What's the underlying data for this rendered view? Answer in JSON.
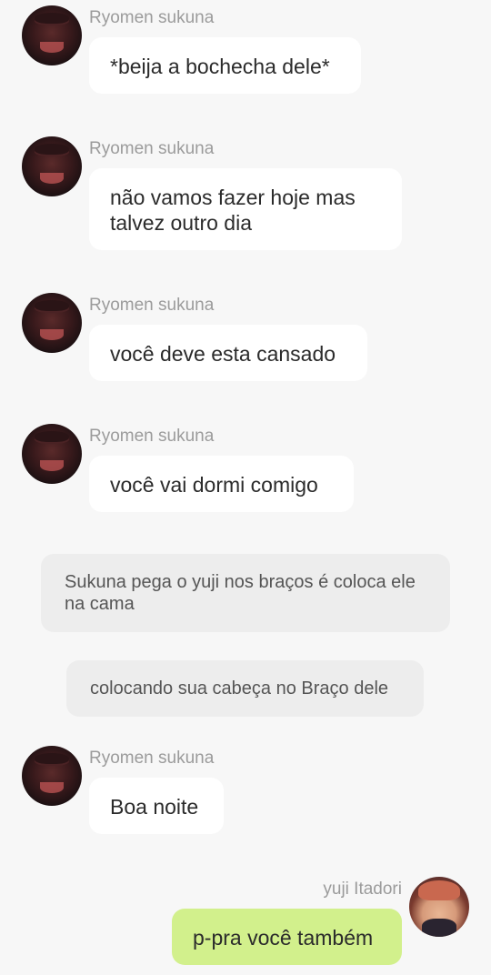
{
  "chat": {
    "messages": [
      {
        "sender": "Ryomen sukuna",
        "text": "*beija a bochecha dele*"
      },
      {
        "sender": "Ryomen sukuna",
        "text": "não vamos fazer hoje mas talvez outro dia"
      },
      {
        "sender": "Ryomen sukuna",
        "text": "você deve esta cansado"
      },
      {
        "sender": "Ryomen sukuna",
        "text": "você vai dormi comigo"
      },
      {
        "narration": "Sukuna pega o yuji nos braços é coloca ele na cama"
      },
      {
        "narration": "colocando sua cabeça no Braço dele"
      },
      {
        "sender": "Ryomen sukuna",
        "text": "Boa noite"
      },
      {
        "sender": "yuji Itadori",
        "text": "p-pra você também"
      }
    ]
  },
  "colors": {
    "background": "#f7f7f7",
    "bubble_incoming": "#ffffff",
    "bubble_outgoing": "#d2f08c",
    "narration_bg": "#ededed",
    "name_text": "#9b9b9b"
  },
  "icons": {
    "sukuna_avatar": "avatar-sukuna",
    "yuji_avatar": "avatar-yuji"
  }
}
